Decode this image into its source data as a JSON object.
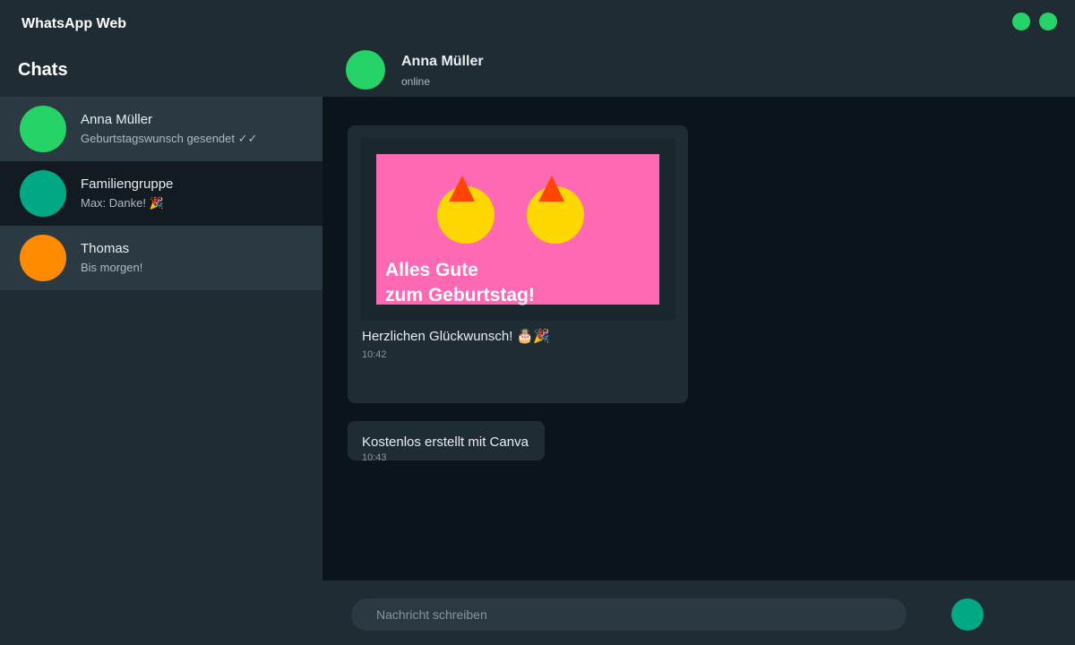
{
  "window": {
    "title": "WhatsApp Web",
    "control_color": "#25d366"
  },
  "sidebar": {
    "header": "Chats",
    "chats": [
      {
        "name": "Anna Müller",
        "preview": "Geburtstagswunsch gesendet ✓✓",
        "avatar_color": "#25d366"
      },
      {
        "name": "Familiengruppe",
        "preview": "Max: Danke! 🎉",
        "avatar_color": "#00a884"
      },
      {
        "name": "Thomas",
        "preview": "Bis morgen!",
        "avatar_color": "#ff8c00"
      }
    ]
  },
  "conversation": {
    "name": "Anna Müller",
    "status": "online",
    "avatar_color": "#25d366"
  },
  "messages": [
    {
      "card": {
        "title_line1": "Alles Gute",
        "title_line2": "zum Geburtstag!",
        "background": "#ff69b4"
      },
      "text": "Herzlichen Glückwunsch! 🎂🎉",
      "time": "10:42"
    },
    {
      "text": "Kostenlos erstellt mit Canva",
      "time": "10:43"
    }
  ],
  "composer": {
    "placeholder": "Nachricht schreiben",
    "send_icon": "send-icon"
  },
  "colors": {
    "accent": "#00a884",
    "panel": "#1f2c34",
    "chat_background": "#0b141a"
  }
}
